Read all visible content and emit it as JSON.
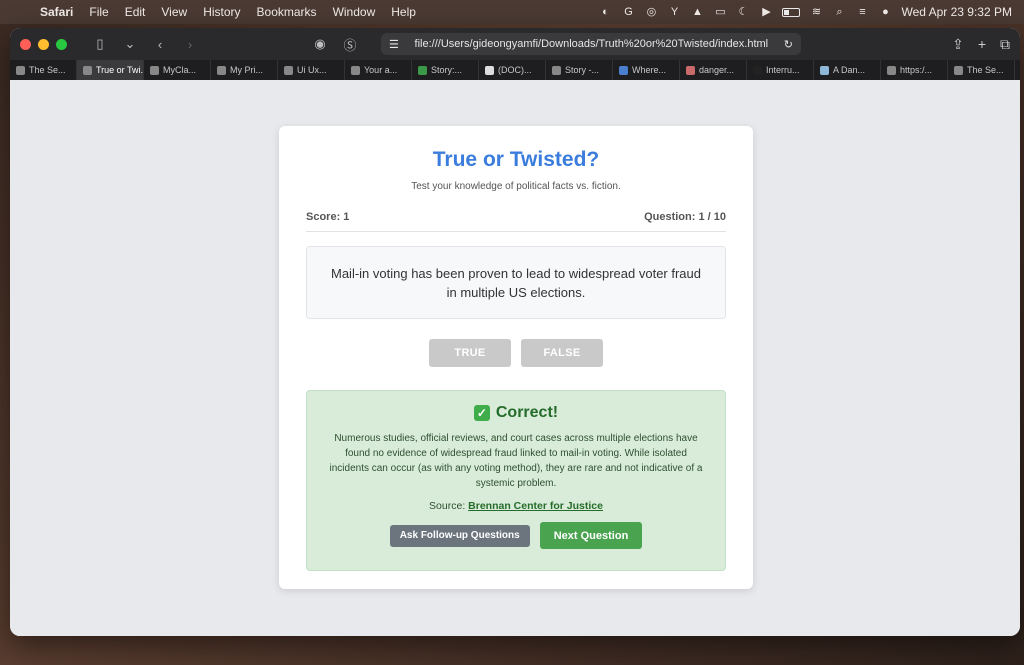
{
  "menubar": {
    "app": "Safari",
    "items": [
      "File",
      "Edit",
      "View",
      "History",
      "Bookmarks",
      "Window",
      "Help"
    ],
    "clock": "Wed Apr 23  9:32 PM"
  },
  "browser": {
    "url": "file:///Users/gideongyamfi/Downloads/Truth%20or%20Twisted/index.html",
    "tabs": [
      {
        "label": "The Se..."
      },
      {
        "label": "True or Twi..."
      },
      {
        "label": "MyCla..."
      },
      {
        "label": "My Pri..."
      },
      {
        "label": "Ui Ux..."
      },
      {
        "label": "Your a..."
      },
      {
        "label": "Story:..."
      },
      {
        "label": "(DOC)..."
      },
      {
        "label": "Story -..."
      },
      {
        "label": "Where..."
      },
      {
        "label": "danger..."
      },
      {
        "label": "Interru..."
      },
      {
        "label": "A Dan..."
      },
      {
        "label": "https:/..."
      },
      {
        "label": "The Se..."
      }
    ]
  },
  "quiz": {
    "title": "True or Twisted?",
    "subtitle": "Test your knowledge of political facts vs. fiction.",
    "score_label": "Score: 1",
    "question_label": "Question: 1 / 10",
    "statement": "Mail-in voting has been proven to lead to widespread voter fraud in multiple US elections.",
    "true_label": "TRUE",
    "false_label": "FALSE"
  },
  "feedback": {
    "heading": "Correct!",
    "explanation": "Numerous studies, official reviews, and court cases across multiple elections have found no evidence of widespread fraud linked to mail-in voting. While isolated incidents can occur (as with any voting method), they are rare and not indicative of a systemic problem.",
    "source_prefix": "Source:",
    "source_name": "Brennan Center for Justice",
    "followup_label": "Ask Follow-up Questions",
    "next_label": "Next Question"
  },
  "colors": {
    "accent_blue": "#3b7ddd",
    "success_green": "#4aa44f",
    "feedback_bg": "#d8ecd9",
    "disabled_gray": "#c9c9c9"
  }
}
